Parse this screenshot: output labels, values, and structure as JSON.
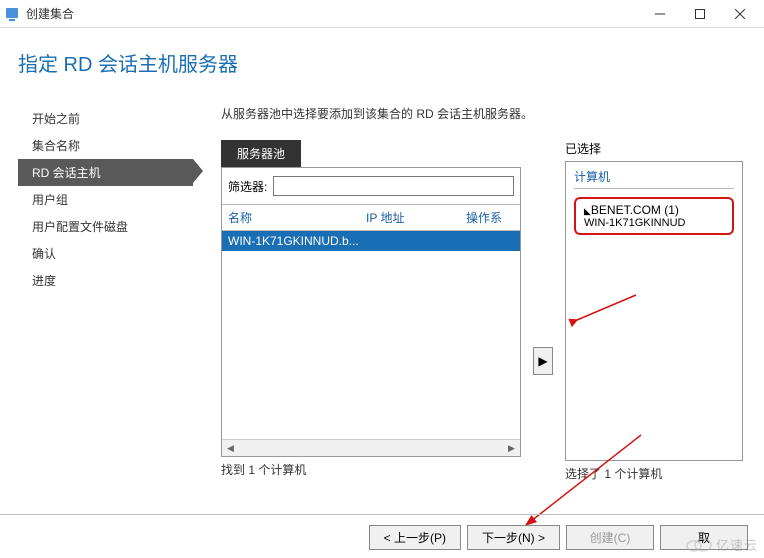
{
  "titlebar": {
    "title": "创建集合"
  },
  "page": {
    "title": "指定 RD 会话主机服务器"
  },
  "sidebar": {
    "items": [
      {
        "label": "开始之前"
      },
      {
        "label": "集合名称"
      },
      {
        "label": "RD 会话主机"
      },
      {
        "label": "用户组"
      },
      {
        "label": "用户配置文件磁盘"
      },
      {
        "label": "确认"
      },
      {
        "label": "进度"
      }
    ],
    "activeIndex": 2
  },
  "main": {
    "instruction": "从服务器池中选择要添加到该集合的 RD 会话主机服务器。",
    "pool": {
      "tab": "服务器池",
      "filterLabel": "筛选器:",
      "filterValue": "",
      "headers": {
        "name": "名称",
        "ip": "IP 地址",
        "os": "操作系"
      },
      "rows": [
        {
          "name": "WIN-1K71GKINNUD.b..."
        }
      ],
      "footer": "找到 1 个计算机"
    },
    "selected": {
      "label": "已选择",
      "header": "计算机",
      "domain": "BENET.COM (1)",
      "host": "WIN-1K71GKINNUD",
      "footer": "选择了 1 个计算机"
    }
  },
  "footer": {
    "prev": "< 上一步(P)",
    "next": "下一步(N) >",
    "create": "创建(C)",
    "cancel": "取"
  },
  "watermark": {
    "text": "亿速云"
  }
}
